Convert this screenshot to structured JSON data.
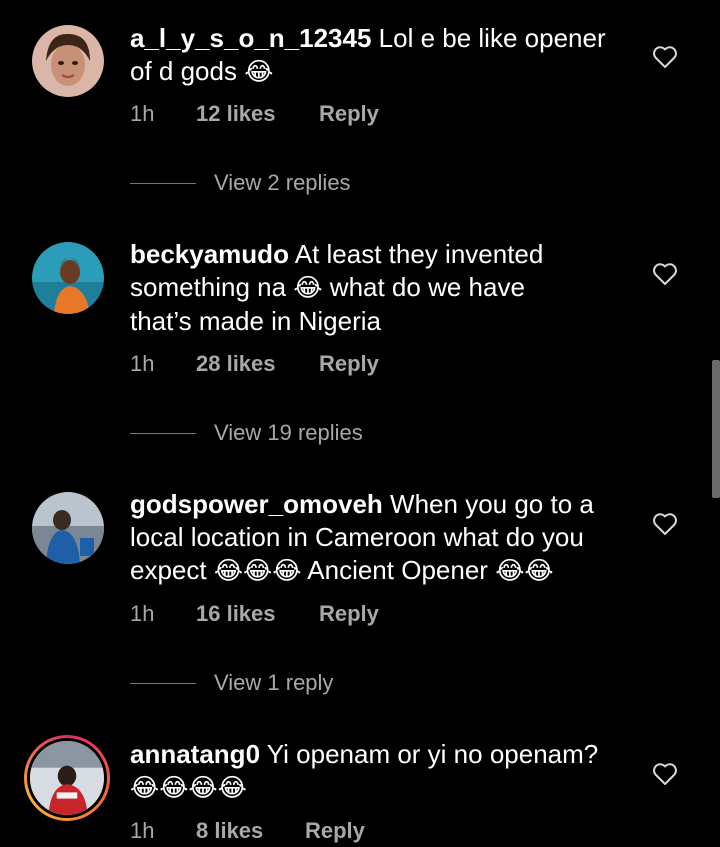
{
  "comments": [
    {
      "username": "a_l_y_s_o_n_12345",
      "text_line1": " Lol e be like opener",
      "text_line2": "of d gods",
      "emoji": "😂",
      "time": "1h",
      "likes": "12 likes",
      "reply": "Reply",
      "view_replies": "View 2 replies"
    },
    {
      "username": "beckyamudo",
      "text_line1": " At least they invented",
      "text_line2a": "something na",
      "emoji": "😂",
      "text_line2b": " what do we have",
      "text_line3": "that’s made in Nigeria",
      "time": "1h",
      "likes": "28 likes",
      "reply": "Reply",
      "view_replies": "View 19 replies"
    },
    {
      "username": "godspower_omoveh",
      "text_line1": " When you go to a",
      "text_line2": "local location in Cameroon what do you",
      "text_line3a": "expect",
      "emoji_a": "😂😂😂",
      "text_line3b": " Ancient Opener",
      "emoji_b": "😂😂",
      "time": "1h",
      "likes": "16 likes",
      "reply": "Reply",
      "view_replies": "View 1 reply"
    },
    {
      "username": "annatang0",
      "text_line1": " Yi openam or yi no openam?",
      "emoji": "😂😂😂😂",
      "time": "1h",
      "likes": "8 likes",
      "reply": "Reply"
    }
  ],
  "icons": {
    "like": "heart-outline-icon"
  },
  "colors": {
    "background": "#000000",
    "text": "#ffffff",
    "secondary": "#a8a8a8",
    "story_ring": "#e02a6f"
  }
}
